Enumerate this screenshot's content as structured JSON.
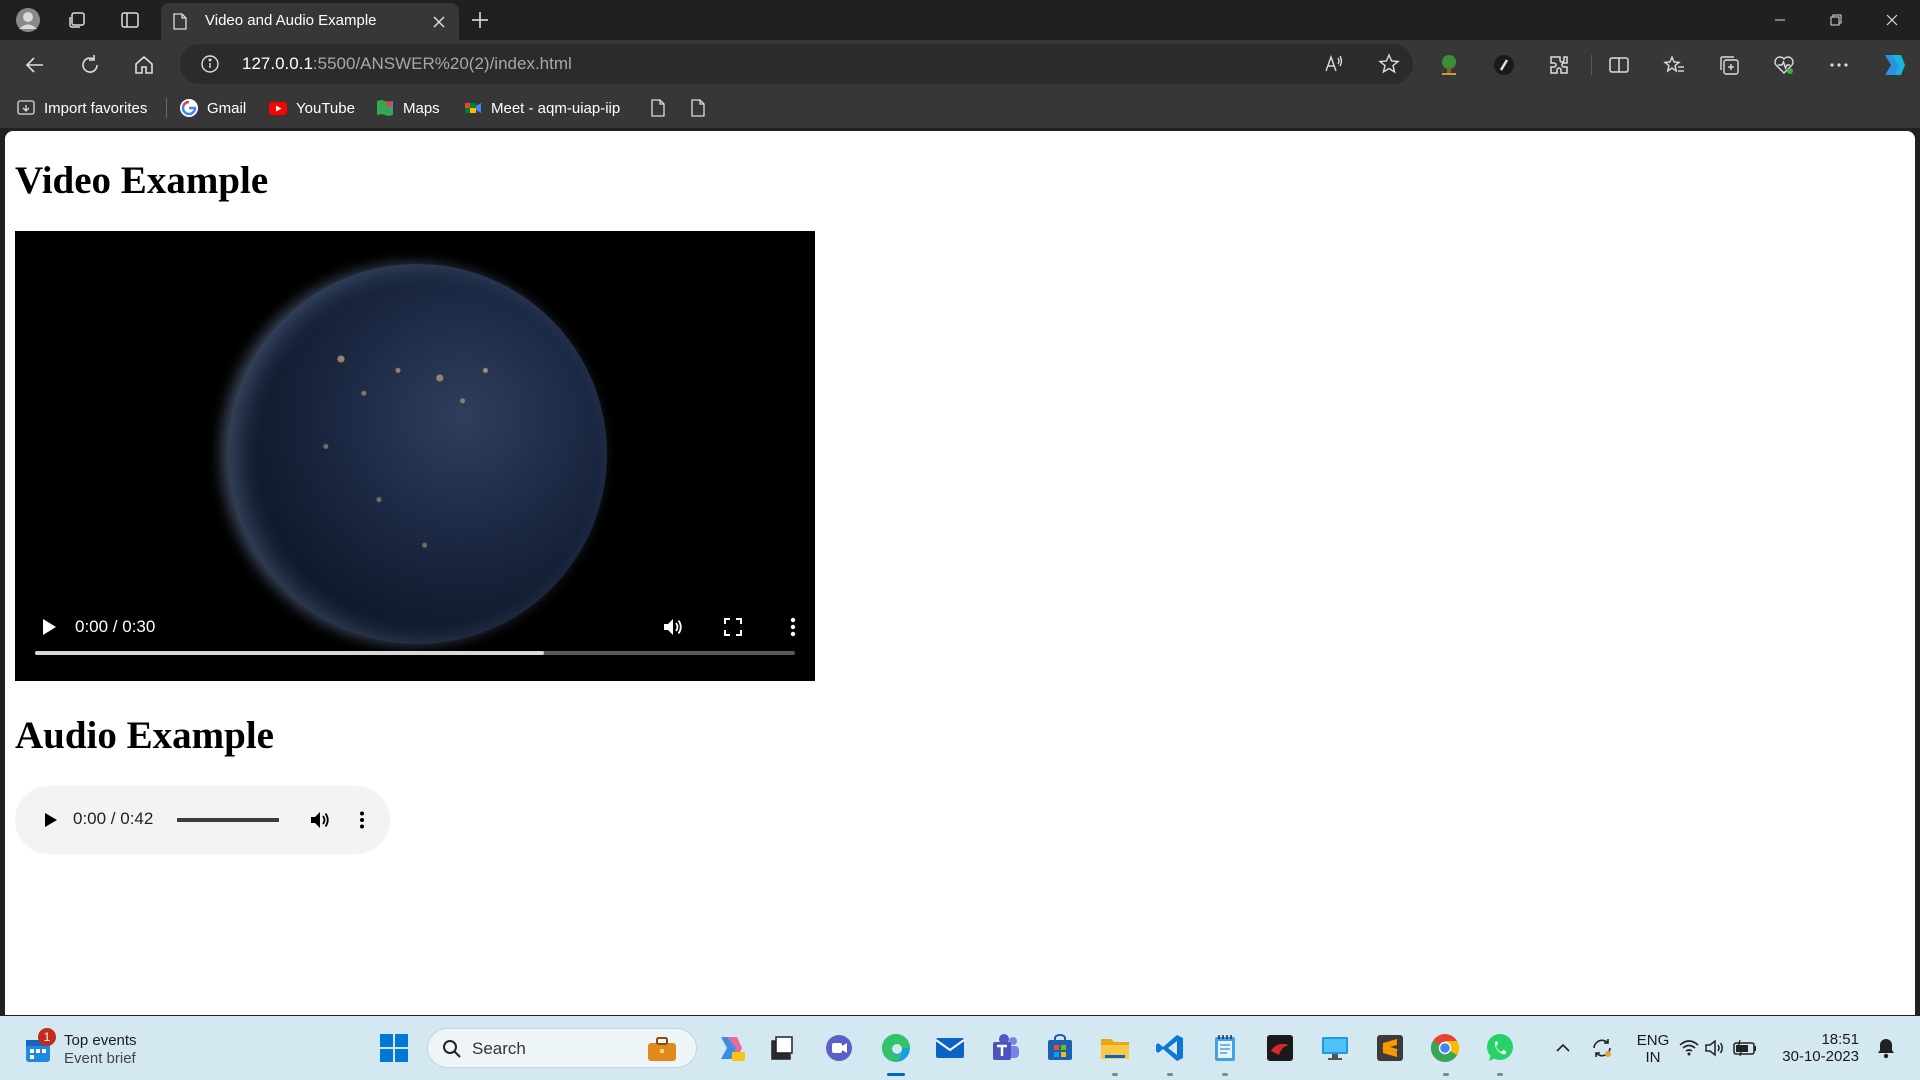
{
  "browser": {
    "tab_title": "Video and Audio Example",
    "url_host": "127.0.0.1",
    "url_rest": ":5500/ANSWER%20(2)/index.html",
    "favorites": [
      "Import favorites",
      "Gmail",
      "YouTube",
      "Maps",
      "Meet - aqm-uiap-iip"
    ]
  },
  "page": {
    "video_heading": "Video Example",
    "audio_heading": "Audio Example",
    "video": {
      "time": "0:00 / 0:30",
      "buffered": 0.67
    },
    "audio": {
      "time": "0:00 / 0:42",
      "volume": 1.0
    }
  },
  "taskbar": {
    "widget_badge": "1",
    "widget_title": "Top events",
    "widget_sub": "Event brief",
    "search_label": "Search",
    "lang_top": "ENG",
    "lang_bottom": "IN",
    "time": "18:51",
    "date": "30-10-2023"
  },
  "colors": {
    "accent": "#0067c0",
    "titlebar": "#202020",
    "toolbar": "#373737",
    "taskbar": "#d4e8f1"
  },
  "icons": [
    "profile-icon",
    "workspaces-icon",
    "tab-actions-icon",
    "page-icon",
    "close-icon",
    "plus-icon",
    "back-icon",
    "refresh-icon",
    "home-icon",
    "info-icon",
    "read-aloud-icon",
    "star-icon",
    "extensions-icon",
    "split-screen-icon",
    "favorites-icon",
    "collections-icon",
    "health-icon",
    "more-icon",
    "copilot-icon"
  ]
}
